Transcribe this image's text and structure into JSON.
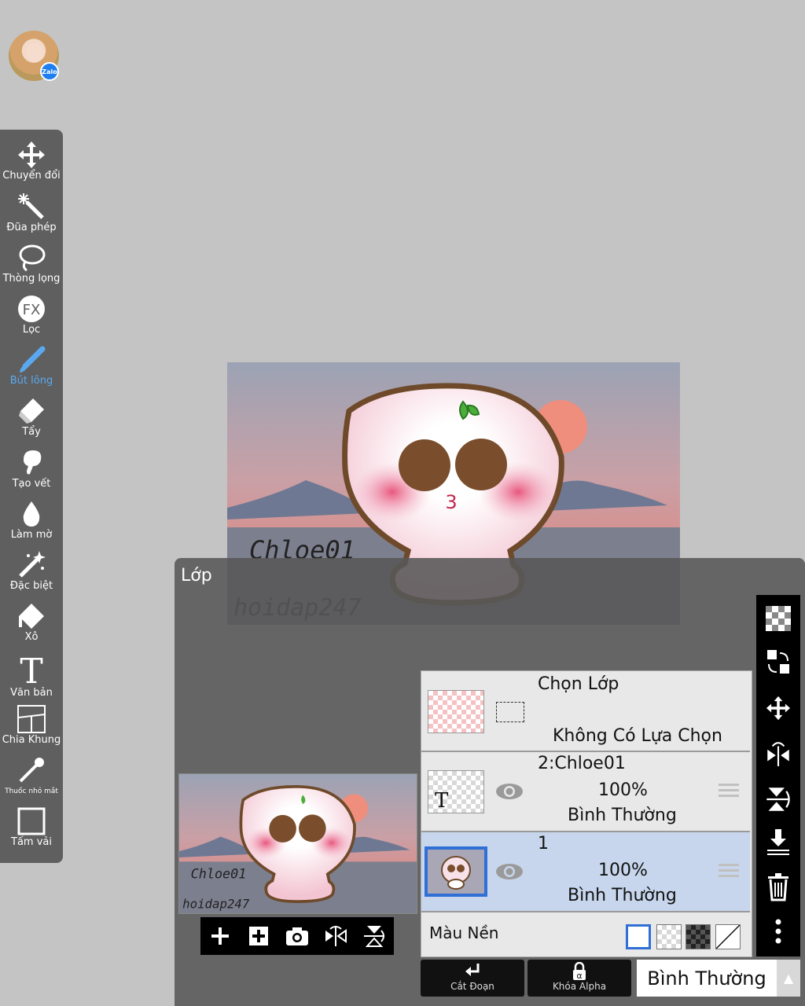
{
  "avatar": {
    "badge": "Zalo"
  },
  "tools": [
    {
      "label": "Chuyển đổi",
      "icon": "move-icon"
    },
    {
      "label": "Đũa phép",
      "icon": "magic-wand-icon"
    },
    {
      "label": "Thòng lọng",
      "icon": "lasso-icon"
    },
    {
      "label": "Lọc",
      "icon": "fx-filter-icon",
      "glyph": "FX"
    },
    {
      "label": "Bút lông",
      "icon": "brush-icon",
      "active": true
    },
    {
      "label": "Tẩy",
      "icon": "eraser-icon"
    },
    {
      "label": "Tạo vết",
      "icon": "smudge-icon"
    },
    {
      "label": "Làm mờ",
      "icon": "blur-drop-icon"
    },
    {
      "label": "Đặc biệt",
      "icon": "special-wand-icon"
    },
    {
      "label": "Xô",
      "icon": "bucket-icon"
    },
    {
      "label": "Văn bản",
      "icon": "text-icon",
      "glyph": "T"
    },
    {
      "label": "Chia Khung",
      "icon": "frame-divider-icon"
    },
    {
      "label": "Thuốc nhỏ mắt",
      "icon": "eyedropper-icon"
    },
    {
      "label": "Tấm vải",
      "icon": "canvas-icon"
    }
  ],
  "canvas": {
    "text1": "Chloe01",
    "text2": "hoidap247",
    "mouth": "3"
  },
  "layer_panel": {
    "title": "Lớp",
    "selection_row": {
      "title": "Chọn Lớp",
      "status": "Không Có Lựa Chọn"
    },
    "layers": [
      {
        "name": "2:Chloe01",
        "opacity": "100%",
        "blend": "Bình Thường",
        "thumb_glyph": "T"
      },
      {
        "name": "1",
        "opacity": "100%",
        "blend": "Bình Thường"
      }
    ],
    "background_label": "Màu Nền"
  },
  "bottom": {
    "clip_label": "Cắt Đoạn",
    "alpha_lock_label": "Khóa Alpha",
    "alpha_glyph": "α",
    "blend_mode": "Bình Thường",
    "arrow_glyph": "▲"
  },
  "colors": {
    "toolbar_bg": "#5f5f5f",
    "active_tool": "#5aa9f0",
    "selected_layer": "#c7d6ec",
    "selected_thumb_border": "#2f6fd6"
  }
}
